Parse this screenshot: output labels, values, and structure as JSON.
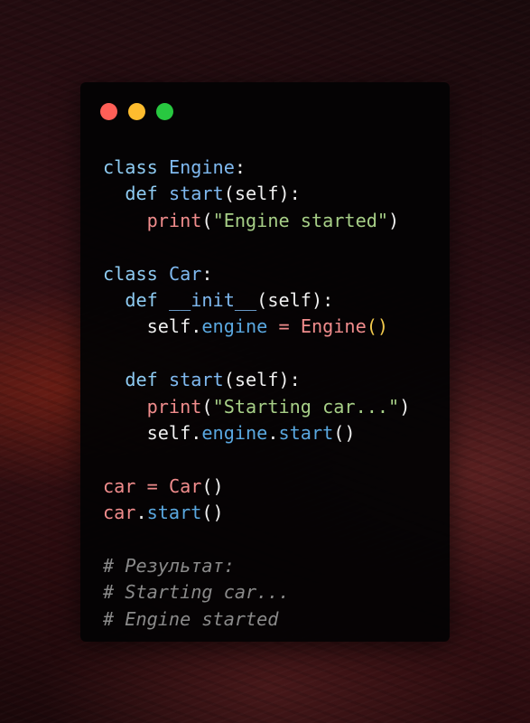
{
  "window": {
    "title": "",
    "traffic_lights": {
      "close_color": "#ff5f57",
      "minimize_color": "#febc2e",
      "maximize_color": "#28c840"
    }
  },
  "code": {
    "language": "python",
    "lines": [
      [
        {
          "t": "class",
          "c": "kw"
        },
        {
          "t": " ",
          "c": "plain"
        },
        {
          "t": "Engine",
          "c": "cls"
        },
        {
          "t": ":",
          "c": "plain"
        }
      ],
      [
        {
          "t": "  ",
          "c": "plain"
        },
        {
          "t": "def",
          "c": "kw"
        },
        {
          "t": " ",
          "c": "plain"
        },
        {
          "t": "start",
          "c": "fn"
        },
        {
          "t": "(self):",
          "c": "plain"
        }
      ],
      [
        {
          "t": "    ",
          "c": "plain"
        },
        {
          "t": "print",
          "c": "builtin"
        },
        {
          "t": "(",
          "c": "plain"
        },
        {
          "t": "\"Engine started\"",
          "c": "str"
        },
        {
          "t": ")",
          "c": "plain"
        }
      ],
      [],
      [
        {
          "t": "class",
          "c": "kw"
        },
        {
          "t": " ",
          "c": "plain"
        },
        {
          "t": "Car",
          "c": "cls"
        },
        {
          "t": ":",
          "c": "plain"
        }
      ],
      [
        {
          "t": "  ",
          "c": "plain"
        },
        {
          "t": "def",
          "c": "kw"
        },
        {
          "t": " ",
          "c": "plain"
        },
        {
          "t": "__init__",
          "c": "fn"
        },
        {
          "t": "(self):",
          "c": "plain"
        }
      ],
      [
        {
          "t": "    ",
          "c": "plain"
        },
        {
          "t": "self",
          "c": "plain"
        },
        {
          "t": ".",
          "c": "plain"
        },
        {
          "t": "engine",
          "c": "attr"
        },
        {
          "t": " ",
          "c": "plain"
        },
        {
          "t": "=",
          "c": "op"
        },
        {
          "t": " ",
          "c": "plain"
        },
        {
          "t": "Engine",
          "c": "builtin"
        },
        {
          "t": "()",
          "c": "paren"
        }
      ],
      [],
      [
        {
          "t": "  ",
          "c": "plain"
        },
        {
          "t": "def",
          "c": "kw"
        },
        {
          "t": " ",
          "c": "plain"
        },
        {
          "t": "start",
          "c": "fn"
        },
        {
          "t": "(self):",
          "c": "plain"
        }
      ],
      [
        {
          "t": "    ",
          "c": "plain"
        },
        {
          "t": "print",
          "c": "builtin"
        },
        {
          "t": "(",
          "c": "plain"
        },
        {
          "t": "\"Starting car...\"",
          "c": "str"
        },
        {
          "t": ")",
          "c": "plain"
        }
      ],
      [
        {
          "t": "    ",
          "c": "plain"
        },
        {
          "t": "self",
          "c": "plain"
        },
        {
          "t": ".",
          "c": "plain"
        },
        {
          "t": "engine",
          "c": "attr"
        },
        {
          "t": ".",
          "c": "plain"
        },
        {
          "t": "start",
          "c": "attr"
        },
        {
          "t": "()",
          "c": "plain"
        }
      ],
      [],
      [
        {
          "t": "car",
          "c": "var"
        },
        {
          "t": " ",
          "c": "plain"
        },
        {
          "t": "=",
          "c": "op"
        },
        {
          "t": " ",
          "c": "plain"
        },
        {
          "t": "Car",
          "c": "builtin"
        },
        {
          "t": "()",
          "c": "plain"
        }
      ],
      [
        {
          "t": "car",
          "c": "var"
        },
        {
          "t": ".",
          "c": "plain"
        },
        {
          "t": "start",
          "c": "attr"
        },
        {
          "t": "()",
          "c": "plain"
        }
      ],
      [],
      [
        {
          "t": "# Результат:",
          "c": "comment"
        }
      ],
      [
        {
          "t": "# Starting car...",
          "c": "comment"
        }
      ],
      [
        {
          "t": "# Engine started",
          "c": "comment"
        }
      ]
    ]
  }
}
